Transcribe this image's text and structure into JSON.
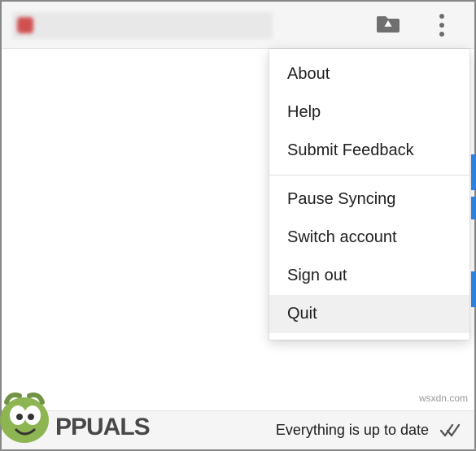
{
  "header": {
    "drive_icon_name": "drive-folder-icon",
    "kebab_icon_name": "more-vert-icon"
  },
  "menu": {
    "group1": [
      {
        "label": "About"
      },
      {
        "label": "Help"
      },
      {
        "label": "Submit Feedback"
      }
    ],
    "group2": [
      {
        "label": "Pause Syncing"
      },
      {
        "label": "Switch account"
      },
      {
        "label": "Sign out"
      },
      {
        "label": "Quit",
        "hovered": true
      }
    ]
  },
  "footer": {
    "status": "Everything is up to date"
  },
  "watermark": {
    "brand": "PPUALS",
    "site": "wsxdn.com"
  }
}
